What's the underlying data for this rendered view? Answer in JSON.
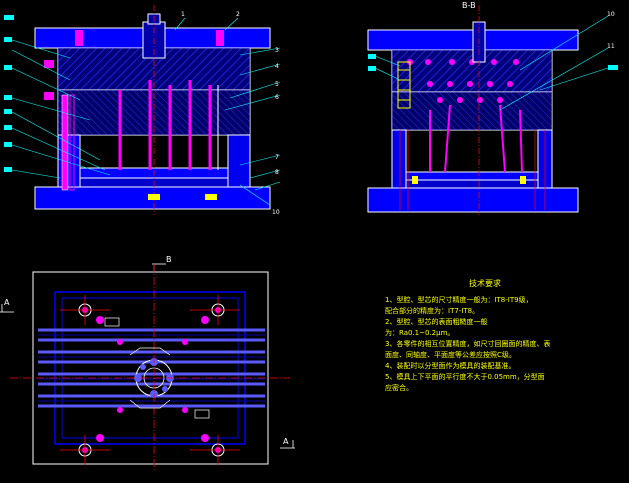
{
  "colors": {
    "background": "#000000",
    "outline": "#ffffff",
    "plate_blue": "#0000ff",
    "plate_hatch": "#5a5ae6",
    "pin_magenta": "#ff00ff",
    "center_red": "#ff0000",
    "leader_cyan": "#00ffff",
    "notes_yellow": "#ffff00",
    "mid_blue": "#3c3cff"
  },
  "views": {
    "section_title": "B-B",
    "section_mark_b": "B",
    "section_mark_a_left": "A",
    "section_mark_a_right": "A"
  },
  "balloons_left": [
    "1",
    "2",
    "3",
    "4",
    "5",
    "6",
    "7",
    "8",
    "10"
  ],
  "balloons_right": [
    "10",
    "11"
  ],
  "notes": {
    "title": "技术要求",
    "lines": [
      "1、型腔、型芯的尺寸精度一般为：IT8-IT9级，",
      "配合部分的精度为：IT7-IT8。",
      "2、型腔、型芯的表面粗糙度一般",
      "为：Ra0.1~0.2μm。",
      "3、各零件的相互位置精度，如尺寸回圈面的精度、表",
      "面度、同轴度、平面度等公差应按照C级。",
      "4、装配时以分型面作为模具的装配基准。",
      "5、模具上下平面的平行度不大于0.05mm，分型面",
      "应密合。"
    ]
  }
}
